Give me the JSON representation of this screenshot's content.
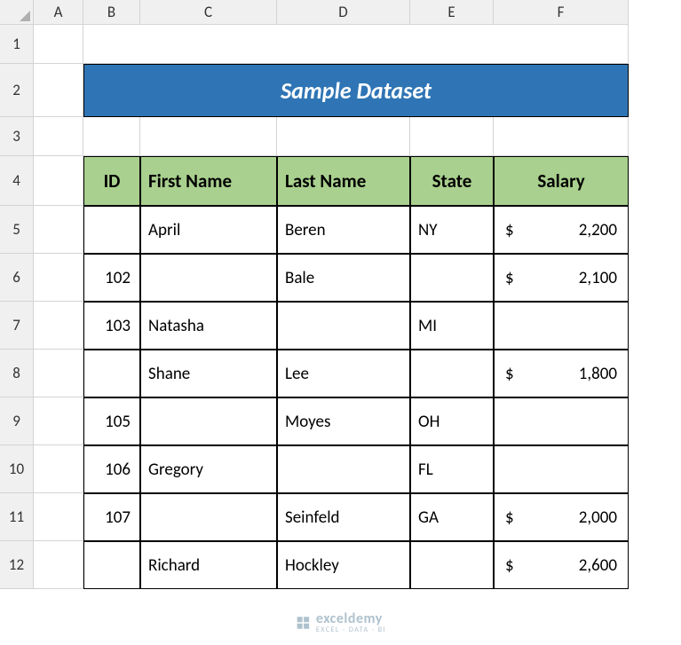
{
  "columns": [
    "A",
    "B",
    "C",
    "D",
    "E",
    "F"
  ],
  "rows": [
    "1",
    "2",
    "3",
    "4",
    "5",
    "6",
    "7",
    "8",
    "9",
    "10",
    "11",
    "12"
  ],
  "title": "Sample Dataset",
  "headers": {
    "id": "ID",
    "first": "First Name",
    "last": "Last Name",
    "state": "State",
    "salary": "Salary"
  },
  "data": [
    {
      "id": "",
      "first": "April",
      "last": "Beren",
      "state": "NY",
      "salary": "2,200"
    },
    {
      "id": "102",
      "first": "",
      "last": "Bale",
      "state": "",
      "salary": "2,100"
    },
    {
      "id": "103",
      "first": "Natasha",
      "last": "",
      "state": "MI",
      "salary": ""
    },
    {
      "id": "",
      "first": "Shane",
      "last": "Lee",
      "state": "",
      "salary": "1,800"
    },
    {
      "id": "105",
      "first": "",
      "last": "Moyes",
      "state": "OH",
      "salary": ""
    },
    {
      "id": "106",
      "first": "Gregory",
      "last": "",
      "state": "FL",
      "salary": ""
    },
    {
      "id": "107",
      "first": "",
      "last": "Seinfeld",
      "state": "GA",
      "salary": "2,000"
    },
    {
      "id": "",
      "first": "Richard",
      "last": "Hockley",
      "state": "",
      "salary": "2,600"
    }
  ],
  "currency": "$",
  "watermark": {
    "brand": "exceldemy",
    "tag": "EXCEL · DATA · BI"
  }
}
